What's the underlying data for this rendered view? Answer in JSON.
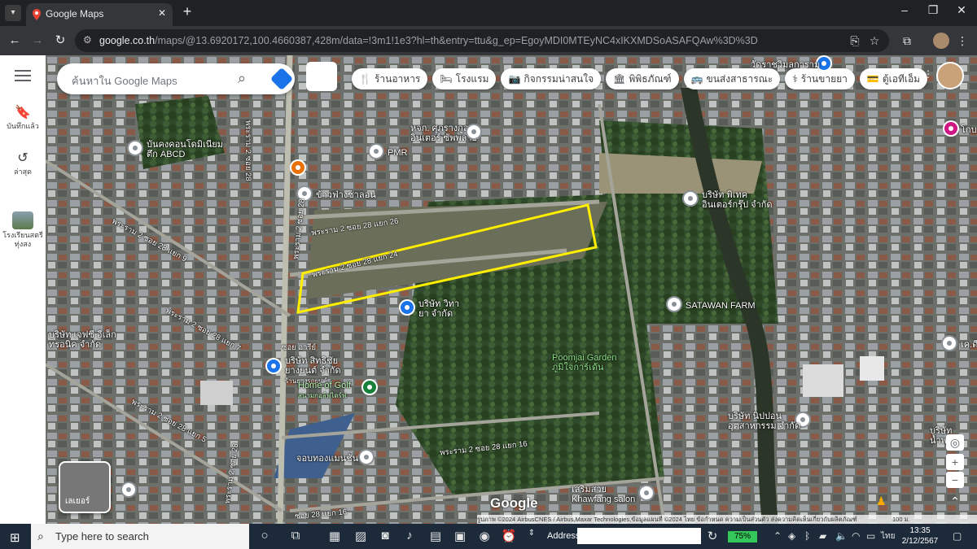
{
  "browser": {
    "tab_title": "Google Maps",
    "url_domain": "google.co.th",
    "url_path": "/maps/@13.6920172,100.4660387,428m/data=!3m1!1e3?hl=th&entry=ttu&g_ep=EgoyMDI0MTEyNC4xIKXMDSoASAFQAw%3D%3D"
  },
  "rail": {
    "saved_label": "บันทึกแล้ว",
    "recent_label": "ล่าสุด",
    "place_label_line1": "โรงเรียนสตรี",
    "place_label_line2": "ทุ่งสง"
  },
  "search": {
    "placeholder": "ค้นหาใน Google Maps"
  },
  "chips": [
    {
      "icon": "restaurant-icon",
      "label": "ร้านอาหาร"
    },
    {
      "icon": "hotel-icon",
      "label": "โรงแรม"
    },
    {
      "icon": "camera-icon",
      "label": "กิจกรรมน่าสนใจ"
    },
    {
      "icon": "museum-icon",
      "label": "พิพิธภัณฑ์"
    },
    {
      "icon": "transit-icon",
      "label": "ขนส่งสาธารณะ"
    },
    {
      "icon": "pharmacy-icon",
      "label": "ร้านขายยา"
    },
    {
      "icon": "atm-icon",
      "label": "ตู้เอทีเอ็ม"
    }
  ],
  "places": {
    "abcd_l1": "บันคงคอนโดมิเนียม",
    "abcd_l2": "ตึก ABCD",
    "pmr": "PMR",
    "thai_rice": "ข้าวฟ่างซาลอน",
    "hok_l1": "หจก. ศุภรางกูล",
    "hok_l2": "อินเตอร์ ซัพพลาย",
    "pic_l1": "บริษัท พิเทค",
    "pic_l2": "อินเตอร์กรุ๊ป จำกัด",
    "vita_l1": "บริษัท วิทา",
    "vita_l2": "ยา จำกัด",
    "satawan": "SATAWAN FARM",
    "jsc_l1": "บริษัท เจฟซี อีเล็ก",
    "jsc_l2": "ทรอนิค จำกัด",
    "sit_l1": "บริษัท สิทธิชัย",
    "sit_l2": "ยางยนต์ จำกัด",
    "sit_l3": "ร้านยางรถยนต์",
    "golf_l1": "Home of Golf",
    "golf_l2": "สนามกอล์ฟไดร์ฟ",
    "poomjai_l1": "Poomjai Garden",
    "poomjai_l2": "ภูมิใจการ์เด้น",
    "nippon_l1": "บริษัท นิปปอน",
    "nippon_l2": "อุตสาหกรรม จำกัด",
    "jorb": "จอบทองแมนชั่น",
    "khawfang_l1": "เสริมสวย",
    "khawfang_l2": "Khawfang salon",
    "right_top": "วัดราชวิมลการาม",
    "right_co_l1": "บริษัท",
    "right_co_l2": "น้ำพลาส",
    "right_edge": "เค.ดี",
    "right_pink": "โกบ"
  },
  "roads": {
    "r1": "พระราม 2 ซอย 28",
    "r2": "พระราม 2 ซอย 28 แยก 26",
    "r3": "พระราม 2 ซอย 28 แยก 24",
    "r4": "พระราม 2 ซอย 28",
    "r5": "พระราม 2 ซอย 28 แยก 9",
    "r6": "พระราม 2 ซอย 28 แยก 7",
    "r7": "พระราม 2 ซอย 28 แยก 5",
    "r8": "พระราม 2 ซอย 28 แยก 16",
    "r9": "พระราม 2 ซอย 28",
    "r10": "ซอย อารีย์",
    "r11": "ซอย 28 แยก 16"
  },
  "map_ui": {
    "layers_label": "เลเยอร์",
    "google_logo": "Google",
    "attribution": "รูปภาพ ©2024 AirbusCNES / Airbus,Maxar Technologies,ข้อมูลแผนที่ ©2024  ไทย  ข้อกำหนด  ความเป็นส่วนตัว  ส่งความคิดเห็นเกี่ยวกับผลิตภัณฑ์",
    "scale": "100 ม."
  },
  "taskbar": {
    "search_placeholder": "Type here to search",
    "address_label": "Address",
    "battery": "75%",
    "lang": "ไทย",
    "time": "13:35",
    "date": "2/12/2567"
  },
  "colors": {
    "highlight": "#ffee00",
    "map_base": "#4f5a48"
  }
}
